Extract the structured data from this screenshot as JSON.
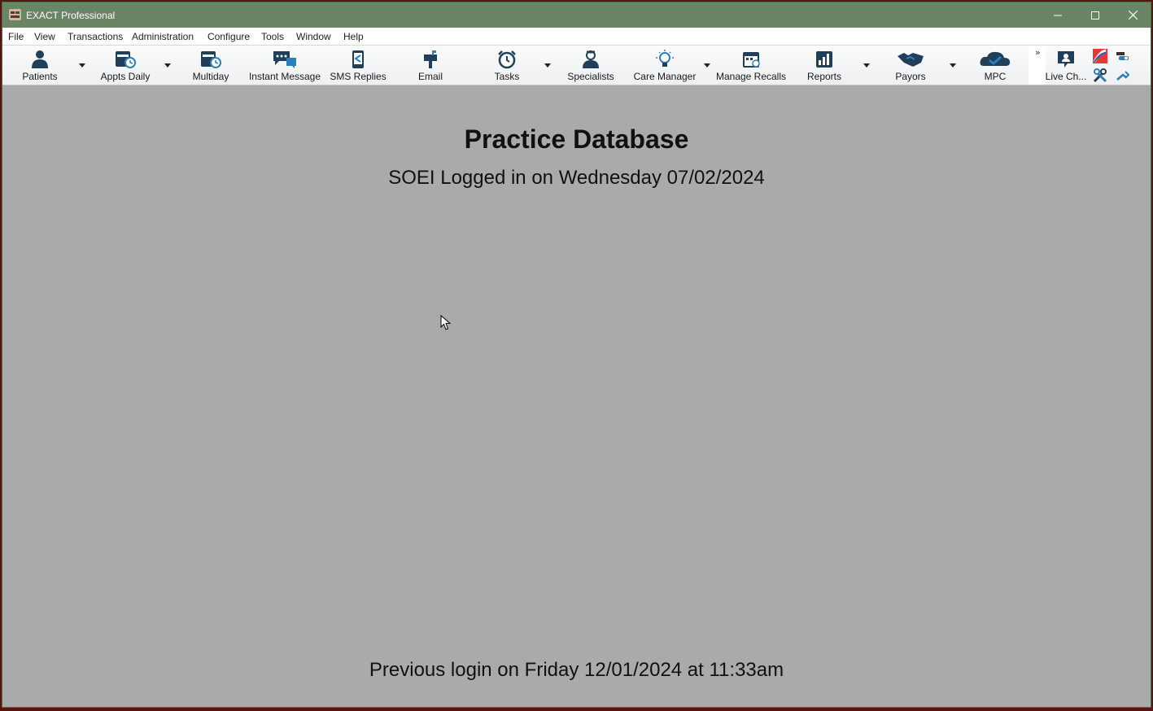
{
  "window": {
    "title": "EXACT Professional",
    "accent_color": "#6a8466",
    "workspace_color": "#a9aaa9"
  },
  "menu": [
    "File",
    "View",
    "Transactions",
    "Administration",
    "Configure",
    "Tools",
    "Window",
    "Help"
  ],
  "toolbar": {
    "buttons": [
      {
        "label": "Patients",
        "icon": "patient-icon"
      },
      {
        "label": "Appts Daily",
        "icon": "appointments-icon"
      },
      {
        "label": "Multiday",
        "icon": "multiday-icon"
      },
      {
        "label": "Instant Message",
        "icon": "chat-icon"
      },
      {
        "label": "SMS Replies",
        "icon": "sms-icon"
      },
      {
        "label": "Email",
        "icon": "mailbox-icon"
      },
      {
        "label": "Tasks",
        "icon": "alarm-clock-icon"
      },
      {
        "label": "Specialists",
        "icon": "specialist-icon"
      },
      {
        "label": "Care Manager",
        "icon": "lightbulb-icon"
      },
      {
        "label": "Manage Recalls",
        "icon": "calendar-icon"
      },
      {
        "label": "Reports",
        "icon": "report-chart-icon"
      },
      {
        "label": "Payors",
        "icon": "handshake-icon"
      },
      {
        "label": "MPC",
        "icon": "cloud-check-icon"
      },
      {
        "label": "Live Ch...",
        "icon": "live-chat-icon"
      }
    ],
    "overflow": "»"
  },
  "content": {
    "title": "Practice Database",
    "login_info": "SOEI Logged in on Wednesday 07/02/2024",
    "previous_login": "Previous login on Friday 12/01/2024 at 11:33am"
  }
}
